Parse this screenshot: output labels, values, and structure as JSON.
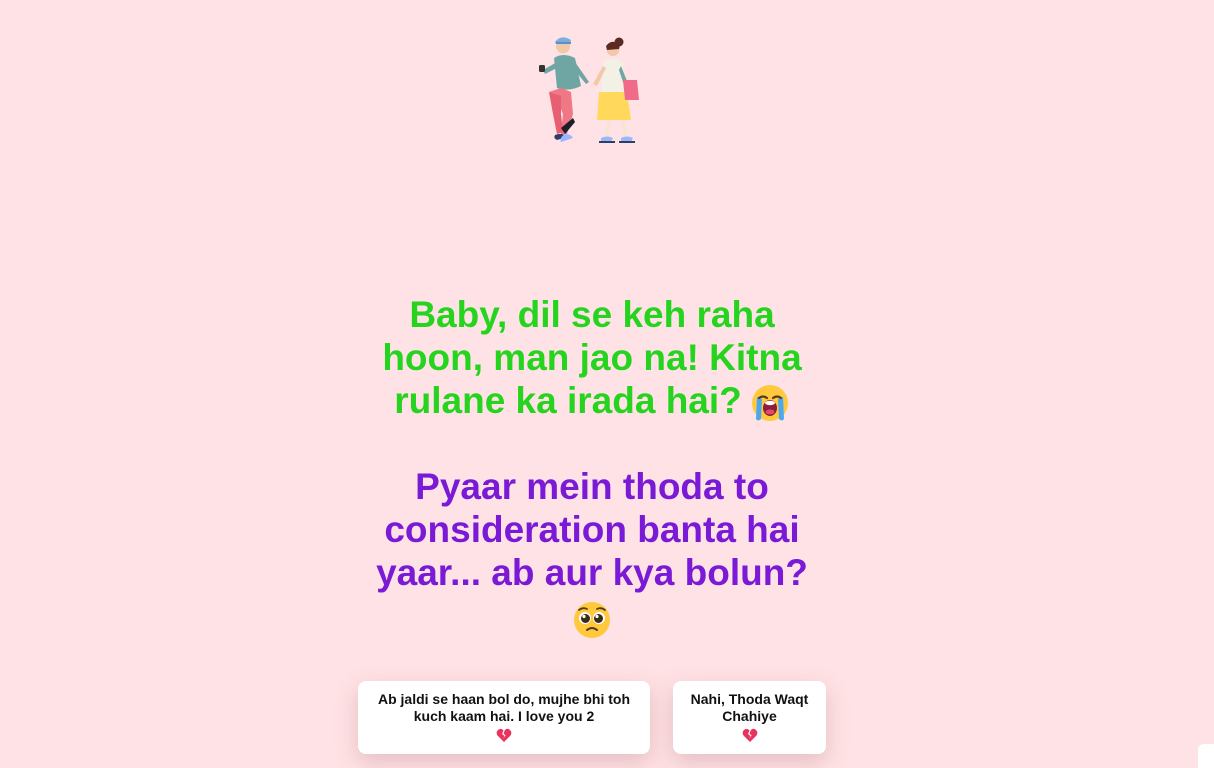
{
  "message_primary": "Baby, dil se keh raha hoon, man jao na! Kitna rulane ka irada hai?",
  "message_secondary": "Pyaar mein thoda to consideration banta hai yaar... ab aur kya bolun?",
  "buttons": {
    "yes_label": "Ab jaldi se haan bol do, mujhe bhi toh kuch kaam hai. I love you 2",
    "no_label": "Nahi, Thoda Waqt Chahiye"
  },
  "icons": {
    "illustration": "couple-walking-icon",
    "primary_emoji": "loudly-crying-face-icon",
    "secondary_emoji": "pleading-face-icon",
    "yes_emoji": "broken-heart-icon",
    "no_emoji": "broken-heart-icon"
  },
  "colors": {
    "background": "#ffe2e5",
    "primary_text": "#26d41f",
    "secondary_text": "#7a1ad6",
    "button_bg": "#ffffff"
  }
}
